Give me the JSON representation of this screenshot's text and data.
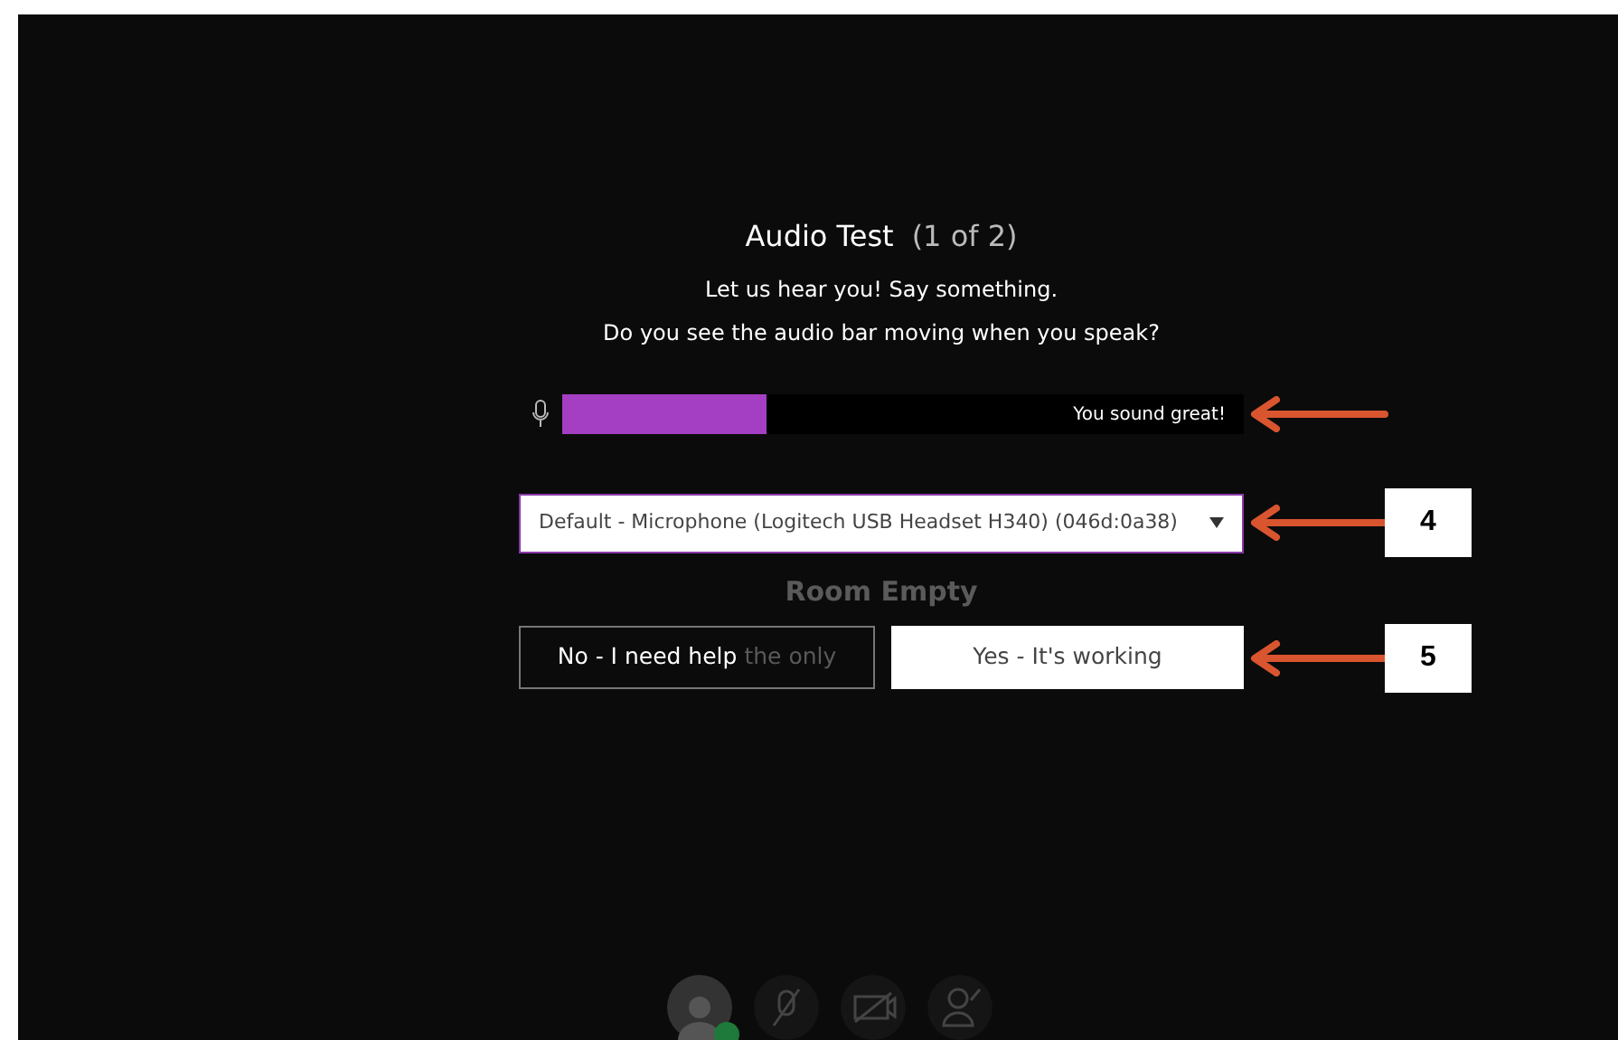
{
  "dialog": {
    "title": "Audio Test",
    "step": "(1 of 2)",
    "lines": [
      "Let us hear you! Say something.",
      "Do you see the audio bar moving when you speak?"
    ]
  },
  "meter": {
    "level": 0.3,
    "reading": "You sound great!",
    "arrow": true
  },
  "device_select": {
    "value": "Default - Microphone (Logitech USB Headset H340) (046d:0a38)",
    "callout": "4"
  },
  "background": {
    "status": "Room Empty",
    "hint": "the only"
  },
  "buttons": [
    {
      "label": "No - I need help",
      "kind": "outline"
    },
    {
      "label": "Yes - It's working",
      "kind": "filled"
    }
  ],
  "buttons_callout": "5"
}
